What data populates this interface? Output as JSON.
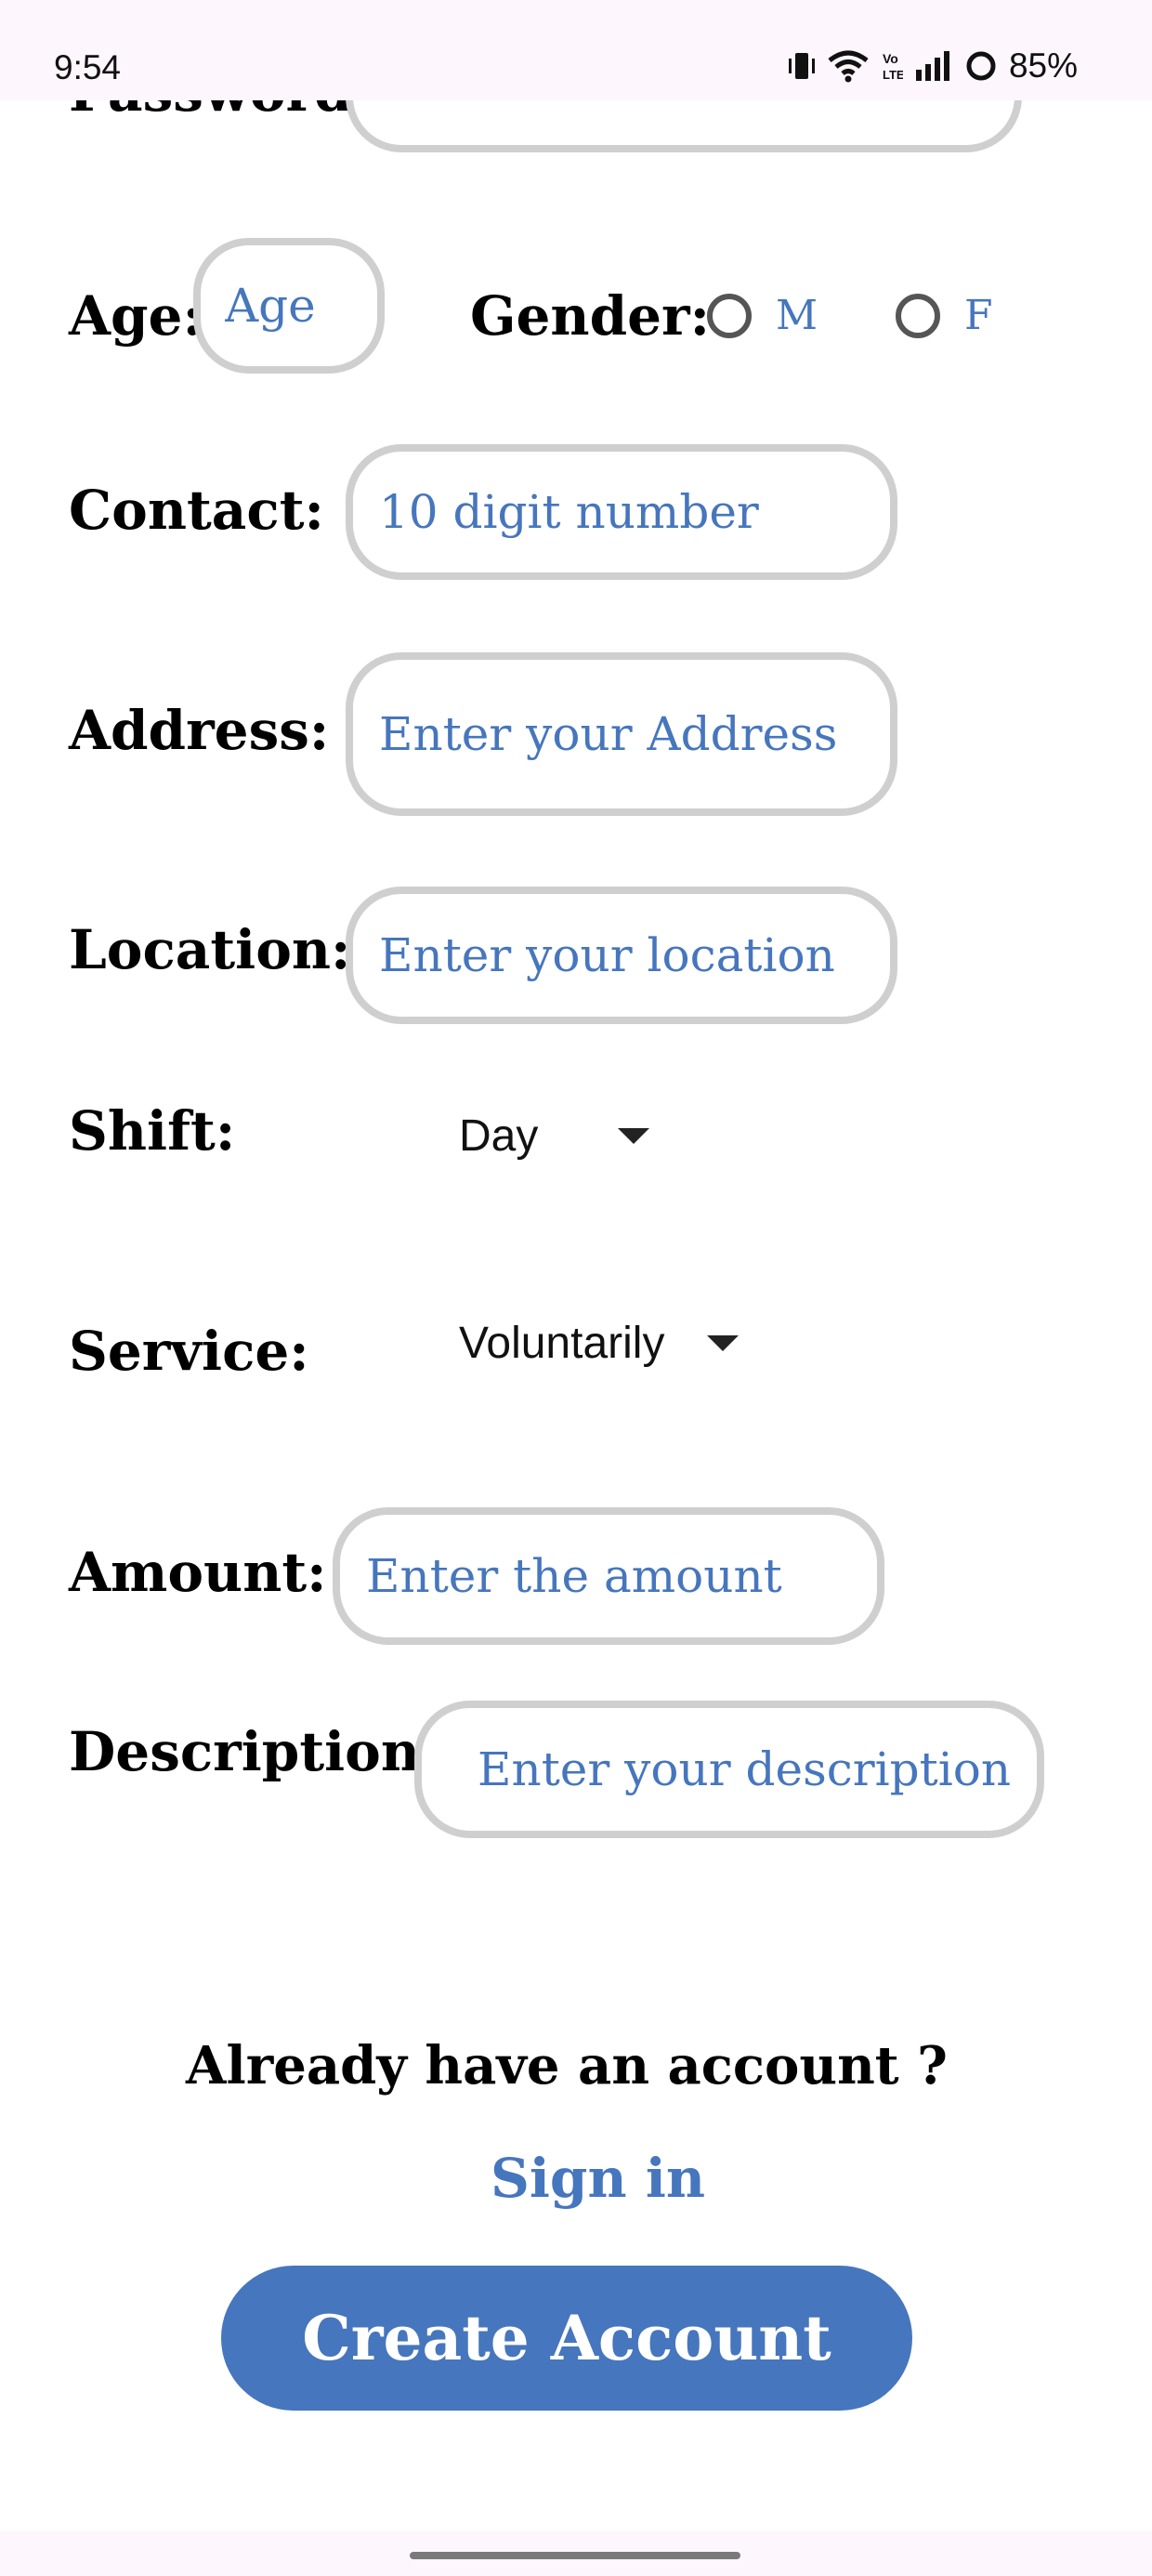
{
  "status_bar": {
    "time": "9:54",
    "battery": "85%",
    "icons": [
      "vibrate-icon",
      "wifi-icon",
      "volte-icon",
      "signal-icon",
      "battery-icon"
    ]
  },
  "form": {
    "password": {
      "label": "Password:",
      "placeholder": ""
    },
    "age": {
      "label": "Age:",
      "placeholder": "Age"
    },
    "gender": {
      "label": "Gender:",
      "options": [
        "M",
        "F"
      ]
    },
    "contact": {
      "label": "Contact:",
      "placeholder": "10 digit number"
    },
    "address": {
      "label": "Address:",
      "placeholder": "Enter your Address"
    },
    "location": {
      "label": "Location:",
      "placeholder": "Enter your location"
    },
    "shift": {
      "label": "Shift:",
      "selected": "Day"
    },
    "service": {
      "label": "Service:",
      "selected": "Voluntarily"
    },
    "amount": {
      "label": "Amount:",
      "placeholder": "Enter the amount"
    },
    "description": {
      "label": "Description:",
      "placeholder": "Enter your description"
    }
  },
  "footer": {
    "signin_prompt": "Already have an account ?",
    "signin_link": "Sign in",
    "create_button": "Create Account"
  },
  "colors": {
    "accent": "#4676bd",
    "field_border": "#cfcfcf",
    "status_bar_bg": "#fdf6fc"
  }
}
